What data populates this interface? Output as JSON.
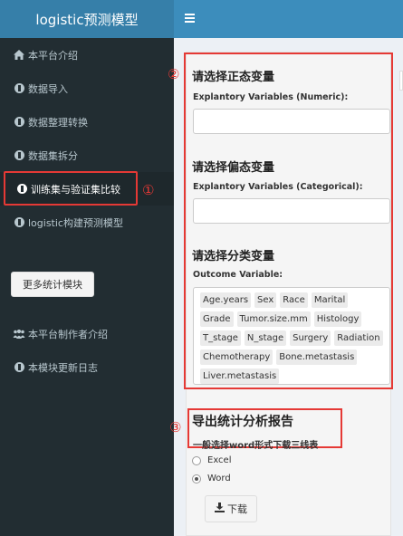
{
  "app": {
    "title": "logistic预测模型"
  },
  "sidebar": {
    "items": [
      {
        "label": "本平台介绍",
        "icon": "home-icon"
      },
      {
        "label": "数据导入",
        "icon": "info-circle-icon"
      },
      {
        "label": "数据整理转换",
        "icon": "info-circle-icon"
      },
      {
        "label": "数据集拆分",
        "icon": "info-circle-icon"
      },
      {
        "label": "训练集与验证集比较",
        "icon": "info-circle-icon",
        "active": true
      },
      {
        "label": "logistic构建预测模型",
        "icon": "info-circle-icon"
      }
    ],
    "more_button": "更多统计模块",
    "bottom_items": [
      {
        "label": "本平台制作者介绍",
        "icon": "users-icon"
      },
      {
        "label": "本模块更新日志",
        "icon": "info-circle-icon"
      }
    ]
  },
  "annotations": {
    "n1": "①",
    "n2": "②",
    "n3": "③"
  },
  "main": {
    "numeric": {
      "title": "请选择正态变量",
      "label": "Explantory Variables (Numeric):",
      "value": ""
    },
    "categorical": {
      "title": "请选择偏态变量",
      "label": "Explantory Variables (Categorical):",
      "value": ""
    },
    "outcome": {
      "title": "请选择分类变量",
      "label": "Outcome Variable:",
      "options": [
        "Age.years",
        "Sex",
        "Race",
        "Marital",
        "Grade",
        "Tumor.size.mm",
        "Histology",
        "T_stage",
        "N_stage",
        "Surgery",
        "Radiation",
        "Chemotherapy",
        "Bone.metastasis",
        "Liver.metastasis"
      ]
    },
    "export": {
      "title": "导出统计分析报告",
      "subtitle": "一般选择word形式下载三线表",
      "options": [
        "Excel",
        "Word"
      ],
      "selected": "Word",
      "download_label": "下载"
    }
  },
  "colors": {
    "sidebar": "#222d32",
    "logo": "#367fa9",
    "header": "#3c8dbc",
    "annotation": "#e53935"
  }
}
